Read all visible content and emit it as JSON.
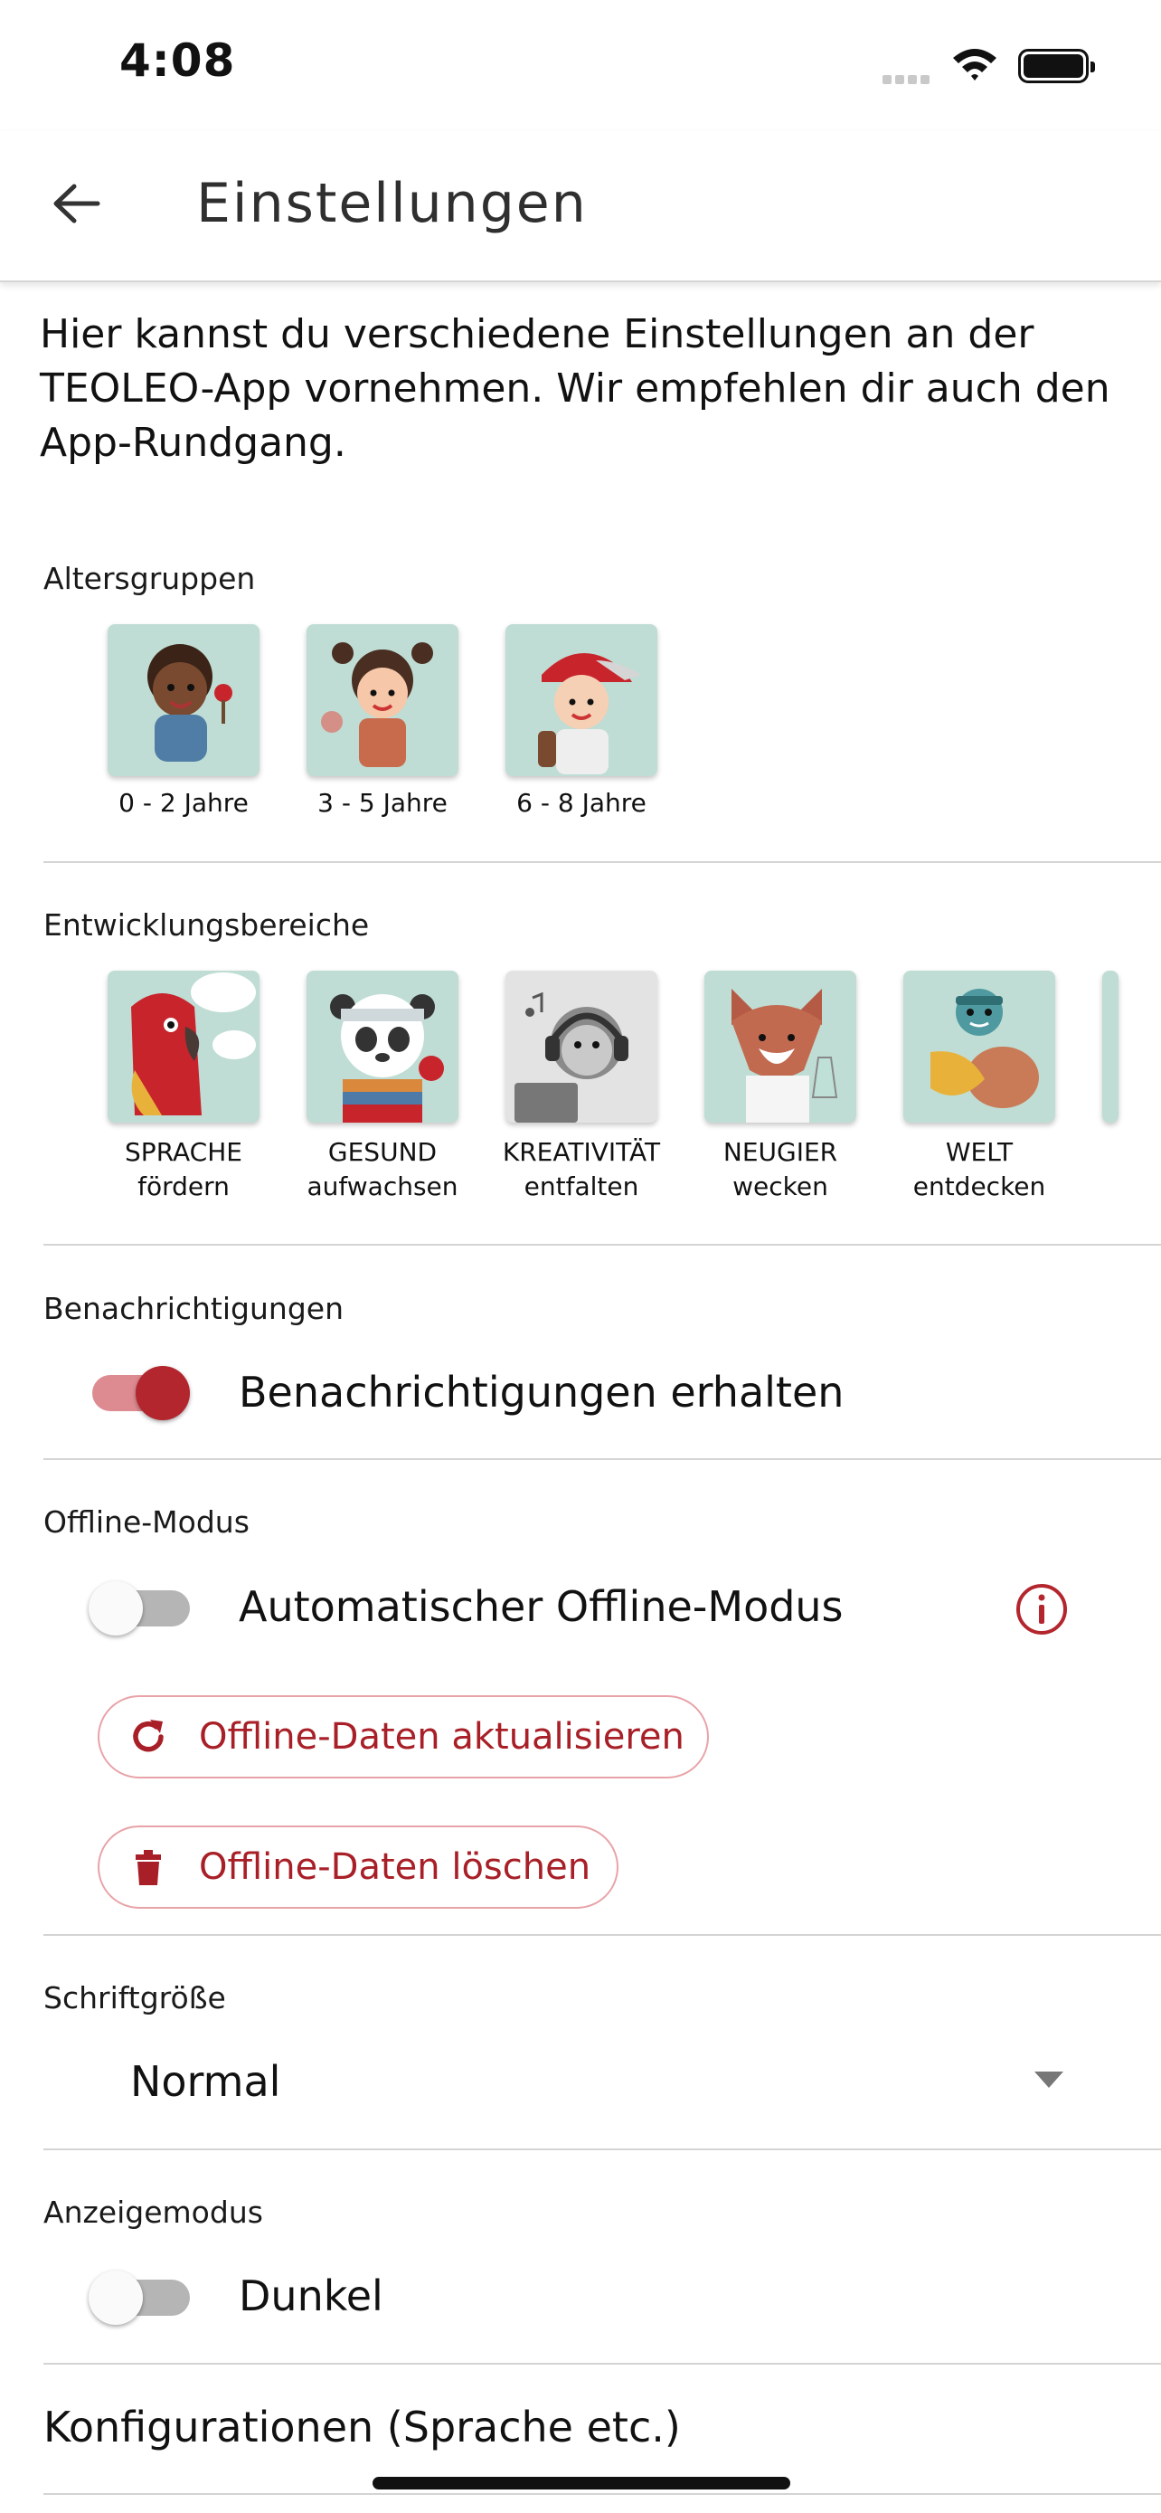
{
  "status": {
    "time": "4:08"
  },
  "header": {
    "title": "Einstellungen"
  },
  "intro": "Hier kannst du verschiedene Einstellungen an der TEOLEO-App vornehmen. Wir empfehlen dir auch den App-Rundgang.",
  "age_groups": {
    "label": "Altersgruppen",
    "items": [
      {
        "label": "0 - 2 Jahre"
      },
      {
        "label": "3 - 5 Jahre"
      },
      {
        "label": "6 - 8 Jahre"
      }
    ]
  },
  "areas": {
    "label": "Entwicklungsbereiche",
    "items": [
      {
        "line1": "SPRACHE",
        "line2": "fördern"
      },
      {
        "line1": "GESUND",
        "line2": "aufwachsen"
      },
      {
        "line1": "KREATIVITÄT",
        "line2": "entfalten"
      },
      {
        "line1": "NEUGIER",
        "line2": "wecken"
      },
      {
        "line1": "WELT",
        "line2": "entdecken"
      }
    ]
  },
  "notifications": {
    "label": "Benachrichtigungen",
    "toggle_label": "Benachrichtigungen erhalten",
    "enabled": true
  },
  "offline": {
    "label": "Offline-Modus",
    "toggle_label": "Automatischer Offline-Modus",
    "enabled": false,
    "refresh_button": "Offline-Daten aktualisieren",
    "delete_button": "Offline-Daten löschen"
  },
  "font_size": {
    "label": "Schriftgröße",
    "value": "Normal"
  },
  "display_mode": {
    "label": "Anzeigemodus",
    "toggle_label": "Dunkel",
    "enabled": false
  },
  "configurations": {
    "label": "Konfigurationen (Sprache etc.)"
  },
  "colors": {
    "accent": "#b3262e",
    "accent_light": "#de8a91",
    "tile_bg": "#bfddd4"
  }
}
